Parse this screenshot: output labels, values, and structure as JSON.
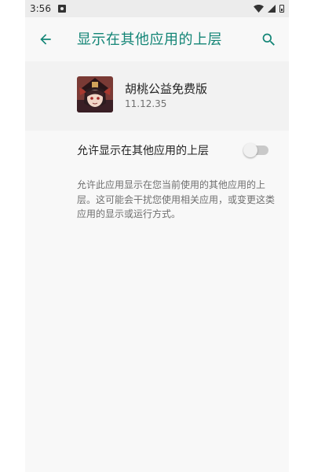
{
  "status_bar": {
    "time": "3:56",
    "icons": [
      "notification-icon",
      "wifi-icon",
      "signal-icon",
      "battery-icon"
    ]
  },
  "app_bar": {
    "title": "显示在其他应用的上层",
    "back_icon": "arrow-left-icon",
    "search_icon": "search-icon"
  },
  "app_info": {
    "name": "胡桃公益免费版",
    "version": "11.12.35",
    "icon": "app-avatar-icon"
  },
  "setting": {
    "label": "允许显示在其他应用的上层",
    "enabled": false
  },
  "description": "允许此应用显示在您当前使用的其他应用的上层。这可能会干扰您使用相关应用，或变更这类应用的显示或运行方式。",
  "colors": {
    "accent": "#138576",
    "background": "#f8f8f8",
    "header_band": "#f2f2f2",
    "primary_text": "#222222",
    "secondary_text": "#6f6f6f"
  }
}
